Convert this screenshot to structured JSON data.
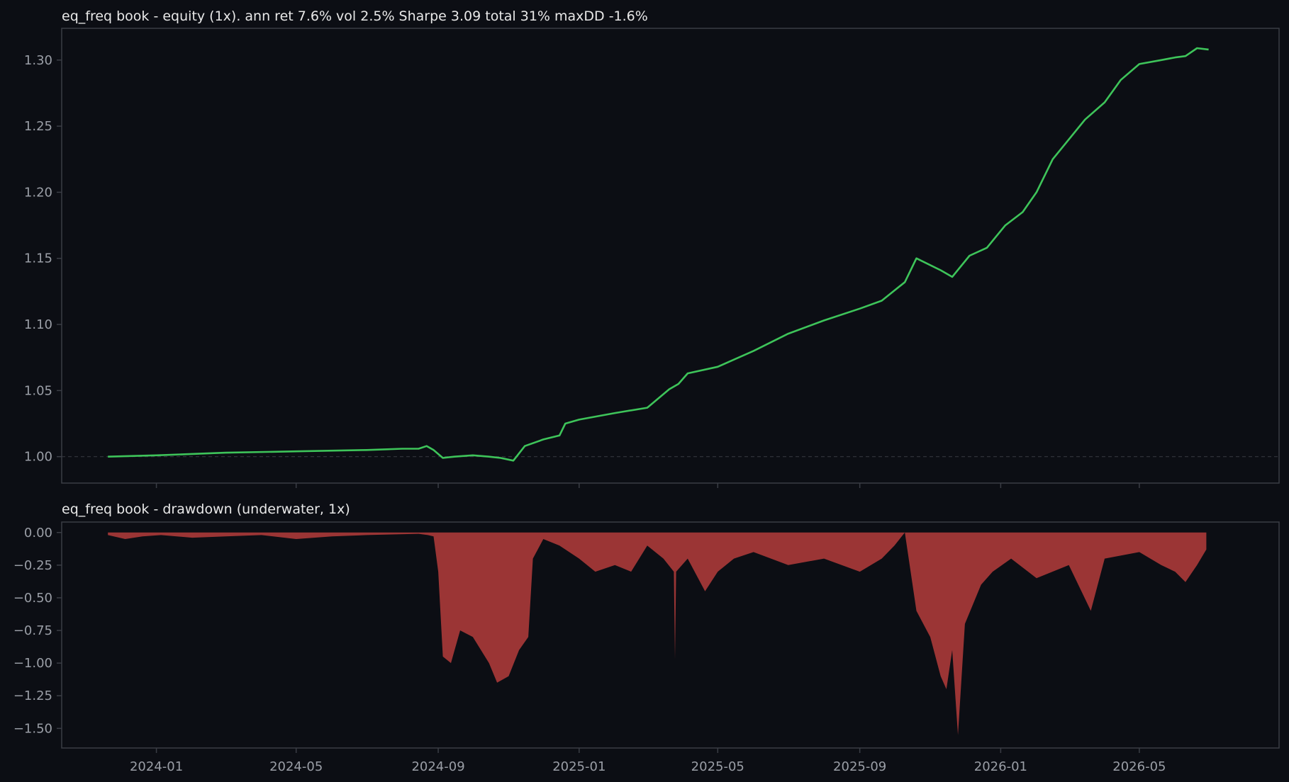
{
  "colors": {
    "background": "#0c0e14",
    "panel_border": "#3a3d45",
    "equity_line": "#3ec45a",
    "drawdown_fill": "#9b3535",
    "reference_line": "#33363e",
    "tick_text": "#9a9ea6",
    "title_text": "#e8e8e8"
  },
  "chart_data": [
    {
      "type": "line",
      "title": "eq_freq book - equity (1x). ann ret 7.6%  vol 2.5%  Sharpe 3.09  total 31%  maxDD -1.6%",
      "xlabel": "",
      "ylabel": "",
      "x_is_date": true,
      "xlim": [
        "2023-10-11",
        "2026-08-30"
      ],
      "ylim": [
        0.98,
        1.324
      ],
      "yticks": [
        "1.00",
        "1.05",
        "1.10",
        "1.15",
        "1.20",
        "1.25",
        "1.30"
      ],
      "reference_line": 1.0,
      "grid": false,
      "series": [
        {
          "x": [
            "2023-11-20",
            "2024-01-01",
            "2024-03-01",
            "2024-05-01",
            "2024-07-01",
            "2024-08-01",
            "2024-08-15",
            "2024-08-22",
            "2024-08-28",
            "2024-09-05",
            "2024-09-15",
            "2024-10-01",
            "2024-10-15",
            "2024-10-25",
            "2024-11-05",
            "2024-11-15",
            "2024-12-01",
            "2024-12-15",
            "2024-12-20",
            "2025-01-01",
            "2025-02-01",
            "2025-03-01",
            "2025-03-20",
            "2025-03-28",
            "2025-04-05",
            "2025-05-01",
            "2025-06-01",
            "2025-07-01",
            "2025-08-01",
            "2025-09-01",
            "2025-09-20",
            "2025-10-10",
            "2025-10-20",
            "2025-11-10",
            "2025-11-20",
            "2025-12-05",
            "2025-12-20",
            "2026-01-05",
            "2026-01-20",
            "2026-02-01",
            "2026-02-15",
            "2026-03-01",
            "2026-03-15",
            "2026-04-01",
            "2026-04-15",
            "2026-05-01",
            "2026-05-20",
            "2026-06-01",
            "2026-06-10",
            "2026-06-20",
            "2026-06-30"
          ],
          "y": [
            1.0,
            1.001,
            1.003,
            1.004,
            1.005,
            1.006,
            1.006,
            1.008,
            1.005,
            0.999,
            1.0,
            1.001,
            1.0,
            0.999,
            0.997,
            1.008,
            1.013,
            1.016,
            1.025,
            1.028,
            1.033,
            1.037,
            1.051,
            1.055,
            1.063,
            1.068,
            1.08,
            1.093,
            1.103,
            1.112,
            1.118,
            1.132,
            1.15,
            1.141,
            1.136,
            1.152,
            1.158,
            1.175,
            1.185,
            1.2,
            1.225,
            1.24,
            1.255,
            1.268,
            1.285,
            1.297,
            1.3,
            1.302,
            1.303,
            1.309,
            1.308
          ]
        }
      ]
    },
    {
      "type": "area",
      "title": "eq_freq book - drawdown (underwater, 1x)",
      "xlabel": "",
      "ylabel": "",
      "x_is_date": true,
      "xlim": [
        "2023-10-11",
        "2026-08-30"
      ],
      "ylim": [
        -1.65,
        0.08
      ],
      "yticks": [
        "0.00",
        "−0.25",
        "−0.50",
        "−0.75",
        "−1.00",
        "−1.25",
        "−1.50"
      ],
      "xticks": [
        "2024-01",
        "2024-05",
        "2024-09",
        "2025-01",
        "2025-05",
        "2025-09",
        "2026-01",
        "2026-05"
      ],
      "grid": false,
      "series": [
        {
          "x": [
            "2023-11-20",
            "2023-12-05",
            "2023-12-20",
            "2024-01-05",
            "2024-02-01",
            "2024-03-01",
            "2024-04-01",
            "2024-05-01",
            "2024-06-01",
            "2024-07-01",
            "2024-08-15",
            "2024-08-23",
            "2024-08-28",
            "2024-09-01",
            "2024-09-05",
            "2024-09-12",
            "2024-09-20",
            "2024-10-01",
            "2024-10-15",
            "2024-10-22",
            "2024-11-01",
            "2024-11-10",
            "2024-11-18",
            "2024-11-22",
            "2024-12-01",
            "2024-12-15",
            "2025-01-01",
            "2025-01-15",
            "2025-02-01",
            "2025-02-15",
            "2025-03-01",
            "2025-03-15",
            "2025-03-24",
            "2025-03-25",
            "2025-03-26",
            "2025-04-05",
            "2025-04-20",
            "2025-05-01",
            "2025-05-15",
            "2025-06-01",
            "2025-07-01",
            "2025-08-01",
            "2025-09-01",
            "2025-09-20",
            "2025-10-01",
            "2025-10-10",
            "2025-10-20",
            "2025-11-01",
            "2025-11-10",
            "2025-11-15",
            "2025-11-20",
            "2025-11-25",
            "2025-12-01",
            "2025-12-15",
            "2025-12-25",
            "2026-01-10",
            "2026-02-01",
            "2026-03-01",
            "2026-03-20",
            "2026-04-01",
            "2026-05-01",
            "2026-05-20",
            "2026-06-01",
            "2026-06-10",
            "2026-06-20",
            "2026-06-28"
          ],
          "y": [
            -0.02,
            -0.05,
            -0.03,
            -0.02,
            -0.04,
            -0.03,
            -0.02,
            -0.05,
            -0.03,
            -0.02,
            -0.01,
            -0.02,
            -0.03,
            -0.3,
            -0.95,
            -1.0,
            -0.75,
            -0.8,
            -1.0,
            -1.15,
            -1.1,
            -0.9,
            -0.8,
            -0.2,
            -0.05,
            -0.1,
            -0.2,
            -0.3,
            -0.25,
            -0.3,
            -0.1,
            -0.2,
            -0.3,
            -0.97,
            -0.3,
            -0.2,
            -0.45,
            -0.3,
            -0.2,
            -0.15,
            -0.25,
            -0.2,
            -0.3,
            -0.2,
            -0.1,
            -0.0,
            -0.6,
            -0.8,
            -1.1,
            -1.2,
            -0.9,
            -1.55,
            -0.7,
            -0.4,
            -0.3,
            -0.2,
            -0.35,
            -0.25,
            -0.6,
            -0.2,
            -0.15,
            -0.25,
            -0.3,
            -0.38,
            -0.25,
            -0.13
          ]
        }
      ]
    }
  ]
}
